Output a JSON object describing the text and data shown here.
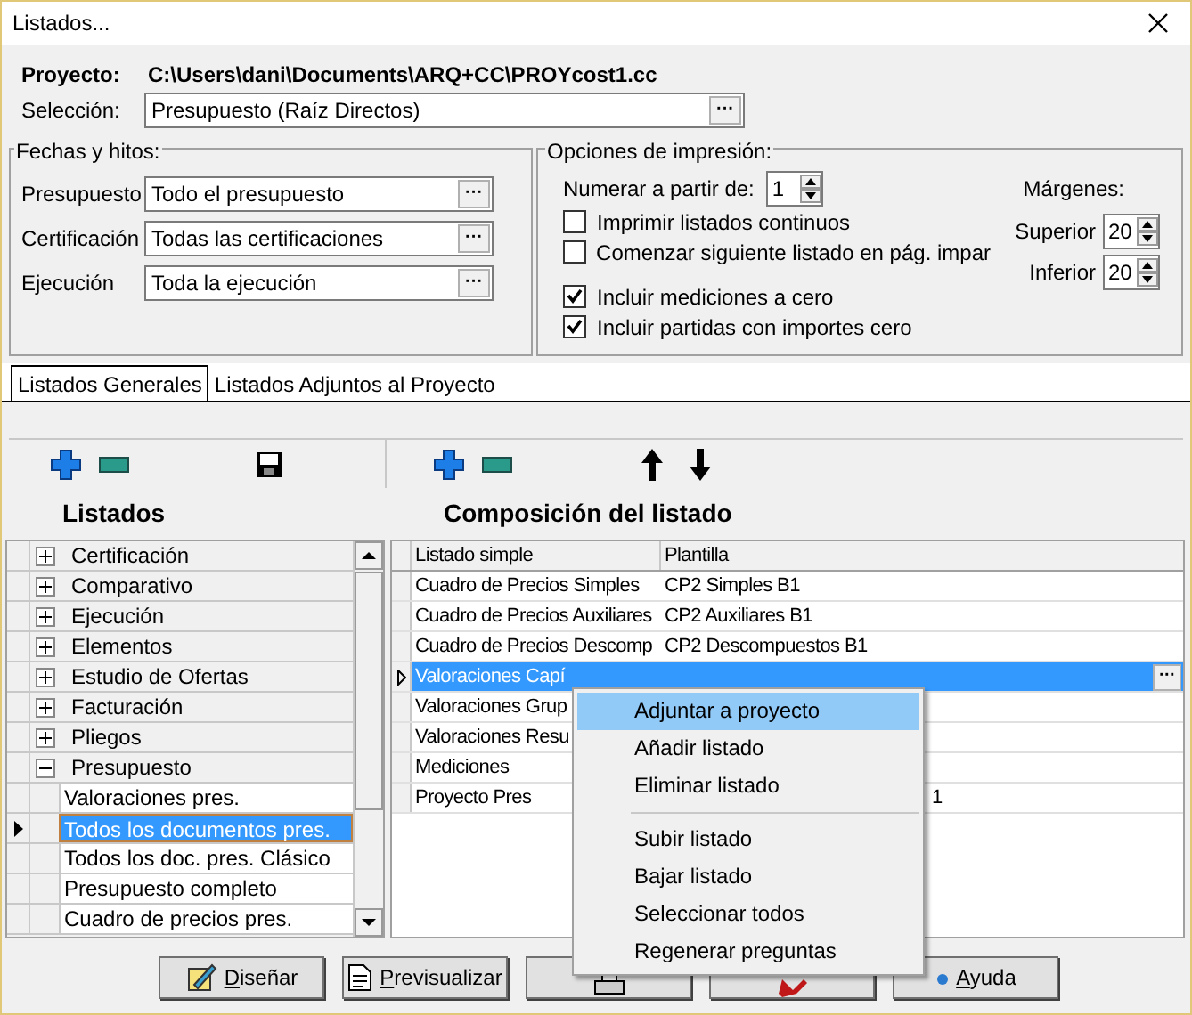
{
  "window": {
    "title": "Listados..."
  },
  "proyecto": {
    "label": "Proyecto:",
    "value": "C:\\Users\\dani\\Documents\\ARQ+CC\\PROYcost1.cc"
  },
  "seleccion": {
    "label": "Selección:",
    "value": "Presupuesto (Raíz Directos)",
    "button": "···"
  },
  "fechas": {
    "title": "Fechas y hitos:",
    "fields": [
      {
        "label": "Presupuesto",
        "value": "Todo el presupuesto",
        "button": "···"
      },
      {
        "label": "Certificación",
        "value": "Todas las certificaciones",
        "button": "···"
      },
      {
        "label": "Ejecución",
        "value": "Toda la ejecución",
        "button": "···"
      }
    ]
  },
  "opciones": {
    "title": "Opciones de impresión:",
    "numerar": {
      "label": "Numerar a partir de:",
      "value": "1"
    },
    "checkboxes": [
      {
        "label": "Imprimir listados continuos",
        "checked": false
      },
      {
        "label": "Comenzar siguiente listado en pág. impar",
        "checked": false
      },
      {
        "label": "Incluir mediciones a cero",
        "checked": true
      },
      {
        "label": "Incluir partidas con importes cero",
        "checked": true
      }
    ],
    "margenes": {
      "title": "Márgenes:",
      "fields": [
        {
          "label": "Superior",
          "value": "20"
        },
        {
          "label": "Inferior",
          "value": "20"
        }
      ]
    }
  },
  "tabs": [
    {
      "label": "Listados Generales",
      "selected": true
    },
    {
      "label": "Listados Adjuntos al Proyecto",
      "selected": false
    }
  ],
  "listados": {
    "title": "Listados",
    "items": [
      {
        "label": "Certificación",
        "expanded": false
      },
      {
        "label": "Comparativo",
        "expanded": false
      },
      {
        "label": "Ejecución",
        "expanded": false
      },
      {
        "label": "Elementos",
        "expanded": false
      },
      {
        "label": "Estudio de Ofertas",
        "expanded": false
      },
      {
        "label": "Facturación",
        "expanded": false
      },
      {
        "label": "Pliegos",
        "expanded": false
      },
      {
        "label": "Presupuesto",
        "expanded": true,
        "children": [
          {
            "label": "Valoraciones pres.",
            "selected": false
          },
          {
            "label": "Todos los documentos pres.",
            "selected": true
          },
          {
            "label": "Todos los doc. pres. Clásico",
            "selected": false
          },
          {
            "label": "Presupuesto completo",
            "selected": false
          },
          {
            "label": "Cuadro de precios pres.",
            "selected": false
          }
        ]
      }
    ]
  },
  "composicion": {
    "title": "Composición del listado",
    "columns": [
      "Listado simple",
      "Plantilla"
    ],
    "rows": [
      {
        "listado": "Cuadro de Precios Simples",
        "plantilla": "CP2 Simples B1",
        "selected": false
      },
      {
        "listado": "Cuadro de Precios Auxiliares",
        "plantilla": "CP2 Auxiliares B1",
        "selected": false
      },
      {
        "listado": "Cuadro de Precios Descomp",
        "plantilla": "CP2 Descompuestos B1",
        "selected": false
      },
      {
        "listado": "Valoraciones Capí",
        "button": "···",
        "selected": true
      },
      {
        "listado": "Valoraciones Grup",
        "selected": false
      },
      {
        "listado": "Valoraciones Resu",
        "selected": false
      },
      {
        "listado": "Mediciones",
        "selected": false
      },
      {
        "listado": "Proyecto Pres",
        "plantilla": "1",
        "kind": "partly_hidden",
        "selected": false
      }
    ]
  },
  "context_menu": {
    "groups": [
      [
        {
          "label": "Adjuntar a proyecto",
          "selected": true
        },
        {
          "label": "Añadir listado",
          "selected": false
        },
        {
          "label": "Eliminar listado",
          "selected": false
        }
      ],
      [
        {
          "label": "Subir listado",
          "selected": false
        },
        {
          "label": "Bajar listado",
          "selected": false
        },
        {
          "label": "Seleccionar todos",
          "selected": false
        },
        {
          "label": "Regenerar preguntas",
          "selected": false
        }
      ]
    ]
  },
  "buttons": [
    {
      "kind": "design",
      "label": "Diseñar"
    },
    {
      "kind": "preview",
      "label": "Previsualizar"
    },
    {
      "kind": "print"
    },
    {
      "kind": "cancel"
    },
    {
      "kind": "help",
      "label": "Ayuda"
    }
  ]
}
